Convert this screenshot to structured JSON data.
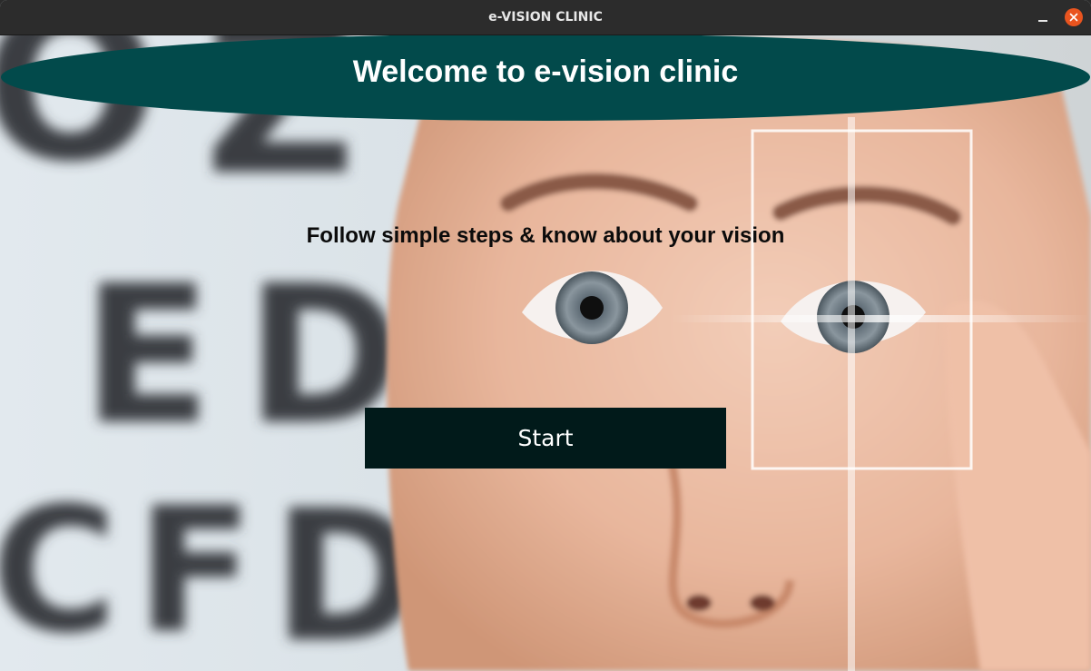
{
  "window": {
    "title": "e-VISION CLINIC"
  },
  "banner": {
    "text": "Welcome to e-vision clinic",
    "color": "#024a4b"
  },
  "subtitle": "Follow simple steps & know about your vision",
  "start_button": {
    "label": "Start",
    "color": "#011a1a"
  },
  "background": {
    "chart_letters": [
      "O",
      "Z",
      "E",
      "D",
      "C",
      "F",
      "D"
    ]
  },
  "icons": {
    "minimize": "minimize-icon",
    "close": "close-icon"
  }
}
